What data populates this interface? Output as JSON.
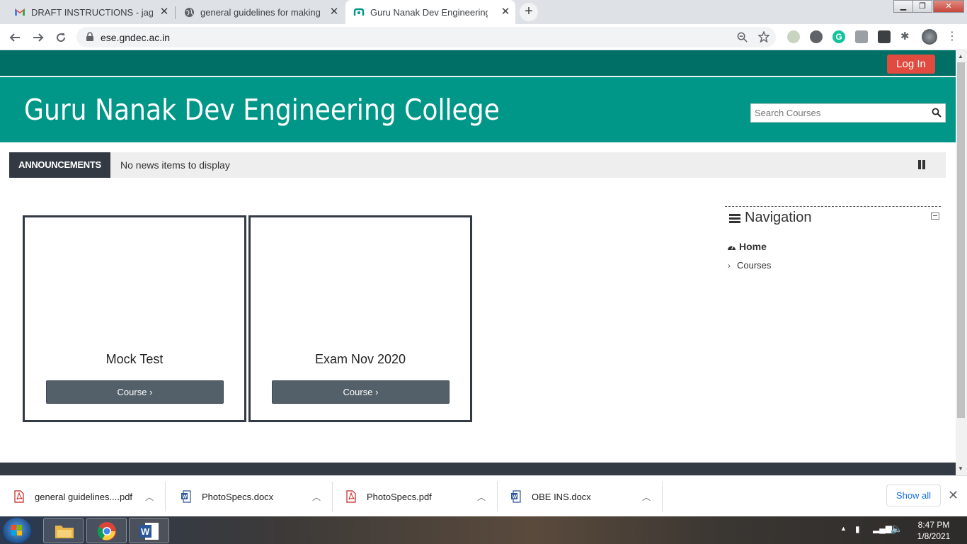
{
  "browser": {
    "tabs": [
      {
        "title": "DRAFT INSTRUCTIONS - jagdeep",
        "favicon": "gmail-icon"
      },
      {
        "title": "general guidelines for making qu",
        "favicon": "globe-icon"
      },
      {
        "title": "Guru Nanak Dev Engineering Col",
        "favicon": "moodle-icon",
        "active": true
      }
    ],
    "url": "ese.gndec.ac.in"
  },
  "page": {
    "login_label": "Log In",
    "site_title": "Guru Nanak Dev Engineering College",
    "search_placeholder": "Search Courses",
    "announcements": {
      "label": "ANNOUNCEMENTS",
      "message": "No news items to display"
    },
    "courses": [
      {
        "name": "Mock Test",
        "button": "Course"
      },
      {
        "name": "Exam Nov 2020",
        "button": "Course"
      }
    ],
    "navigation": {
      "title": "Navigation",
      "home": "Home",
      "courses": "Courses"
    },
    "colors": {
      "topbar": "#006f66",
      "header": "#009688",
      "login": "#e04a3f",
      "announce_label": "#333a43",
      "course_button": "#546069"
    }
  },
  "downloads": {
    "items": [
      {
        "name": "general guidelines....pdf",
        "type": "pdf"
      },
      {
        "name": "PhotoSpecs.docx",
        "type": "docx"
      },
      {
        "name": "PhotoSpecs.pdf",
        "type": "pdf"
      },
      {
        "name": "OBE INS.docx",
        "type": "docx"
      }
    ],
    "show_all": "Show all"
  },
  "taskbar": {
    "time": "8:47 PM",
    "date": "1/8/2021"
  }
}
